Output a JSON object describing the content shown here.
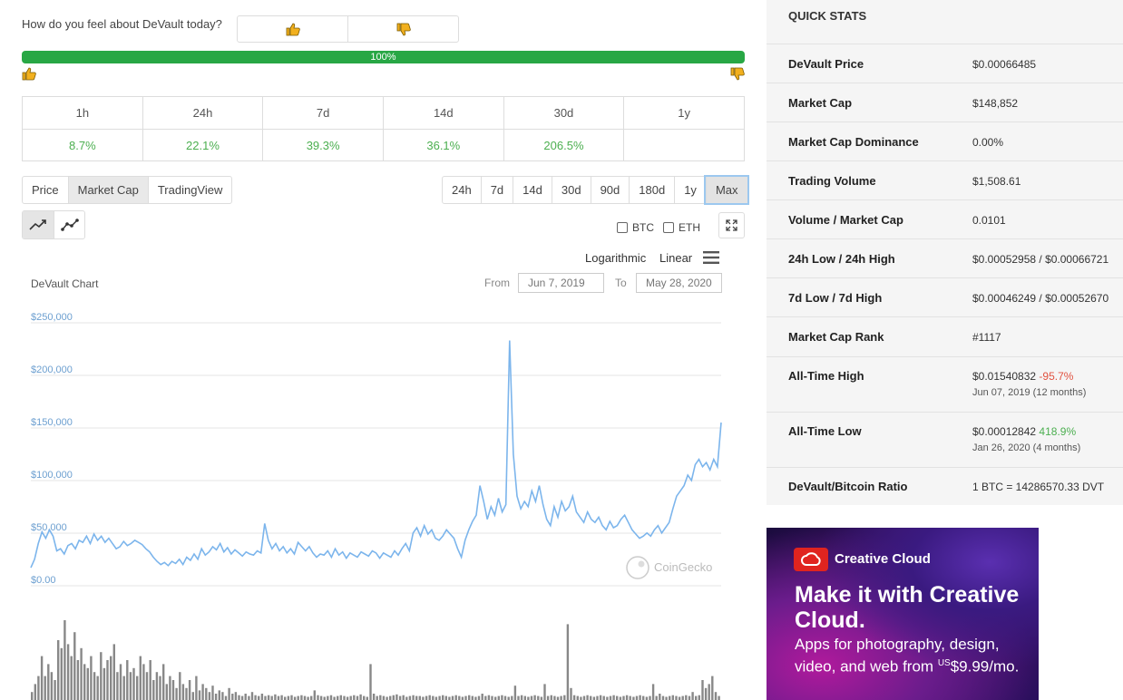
{
  "sentiment": {
    "question": "How do you feel about DeVault today?",
    "up_pct_label": "100%",
    "up_fraction": 1.0
  },
  "periods": {
    "headers": [
      "1h",
      "24h",
      "7d",
      "14d",
      "30d",
      "1y"
    ],
    "values": [
      "8.7%",
      "22.1%",
      "39.3%",
      "36.1%",
      "206.5%",
      ""
    ]
  },
  "chart_tabs": [
    "Price",
    "Market Cap",
    "TradingView"
  ],
  "active_chart_tab": "Market Cap",
  "range_tabs": [
    "24h",
    "7d",
    "14d",
    "30d",
    "90d",
    "180d",
    "1y",
    "Max"
  ],
  "active_range": "Max",
  "compare": {
    "btc": "BTC",
    "eth": "ETH"
  },
  "scale": {
    "log": "Logarithmic",
    "linear": "Linear"
  },
  "chart_title": "DeVault Chart",
  "date_range": {
    "from_label": "From",
    "from": "Jun 7, 2019",
    "to_label": "To",
    "to": "May 28, 2020"
  },
  "watermark": "CoinGecko",
  "chart_data": {
    "type": "area",
    "title": "DeVault Chart",
    "xlabel": "",
    "ylabel": "",
    "ylim": [
      0,
      250000
    ],
    "yticks": [
      "$0.00",
      "$50,000",
      "$100,000",
      "$150,000",
      "$200,000",
      "$250,000"
    ],
    "x_range": [
      "2019-06-07",
      "2020-05-28"
    ],
    "series": [
      {
        "values": [
          12000,
          20000,
          35000,
          46000,
          40000,
          48000,
          42000,
          28000,
          30000,
          25000,
          33000,
          35000,
          30000,
          38000,
          36000,
          42000,
          35000,
          44000,
          38000,
          42000,
          36000,
          40000,
          35000,
          30000,
          32000,
          37000,
          33000,
          35000,
          38000,
          36000,
          34000,
          30000,
          27000,
          22000,
          18000,
          15000,
          17000,
          14000,
          18000,
          16000,
          20000,
          15000,
          22000,
          19000,
          25000,
          20000,
          30000,
          24000,
          27000,
          32000,
          29000,
          35000,
          27000,
          31000,
          25000,
          29000,
          26000,
          23000,
          27000,
          25000,
          24000,
          28000,
          26000,
          54000,
          38000,
          30000,
          35000,
          28000,
          32000,
          26000,
          30000,
          25000,
          36000,
          32000,
          28000,
          32000,
          26000,
          22000,
          25000,
          24000,
          28000,
          22000,
          30000,
          24000,
          27000,
          21000,
          26000,
          24000,
          22000,
          27000,
          25000,
          23000,
          28000,
          26000,
          21000,
          26000,
          24000,
          22000,
          28000,
          24000,
          30000,
          35000,
          28000,
          45000,
          50000,
          42000,
          52000,
          44000,
          48000,
          40000,
          38000,
          42000,
          48000,
          44000,
          40000,
          30000,
          22000,
          38000,
          48000,
          56000,
          62000,
          90000,
          75000,
          58000,
          70000,
          62000,
          78000,
          65000,
          72000,
          228000,
          120000,
          80000,
          68000,
          75000,
          70000,
          85000,
          75000,
          90000,
          72000,
          58000,
          52000,
          70000,
          60000,
          75000,
          66000,
          70000,
          80000,
          65000,
          60000,
          55000,
          65000,
          58000,
          55000,
          60000,
          52000,
          48000,
          56000,
          50000,
          52000,
          58000,
          62000,
          55000,
          48000,
          44000,
          40000,
          42000,
          45000,
          42000,
          48000,
          52000,
          45000,
          50000,
          55000,
          68000,
          80000,
          85000,
          90000,
          100000,
          95000,
          110000,
          115000,
          108000,
          112000,
          105000,
          115000,
          108000,
          150000
        ]
      }
    ],
    "volume_relative": [
      0.1,
      0.2,
      0.3,
      0.55,
      0.3,
      0.45,
      0.35,
      0.25,
      0.75,
      0.65,
      1.0,
      0.7,
      0.55,
      0.85,
      0.5,
      0.65,
      0.45,
      0.4,
      0.55,
      0.35,
      0.3,
      0.6,
      0.4,
      0.5,
      0.55,
      0.7,
      0.35,
      0.45,
      0.3,
      0.5,
      0.35,
      0.4,
      0.3,
      0.55,
      0.45,
      0.35,
      0.5,
      0.25,
      0.35,
      0.3,
      0.45,
      0.2,
      0.3,
      0.25,
      0.15,
      0.35,
      0.2,
      0.15,
      0.25,
      0.1,
      0.3,
      0.12,
      0.2,
      0.15,
      0.1,
      0.18,
      0.08,
      0.12,
      0.1,
      0.05,
      0.15,
      0.08,
      0.1,
      0.06,
      0.05,
      0.08,
      0.05,
      0.1,
      0.06,
      0.05,
      0.08,
      0.05,
      0.06,
      0.05,
      0.07,
      0.05,
      0.06,
      0.04,
      0.05,
      0.06,
      0.04,
      0.05,
      0.06,
      0.05,
      0.04,
      0.05,
      0.12,
      0.06,
      0.05,
      0.04,
      0.05,
      0.06,
      0.04,
      0.05,
      0.06,
      0.05,
      0.04,
      0.05,
      0.06,
      0.05,
      0.07,
      0.05,
      0.04,
      0.45,
      0.08,
      0.05,
      0.06,
      0.05,
      0.04,
      0.05,
      0.06,
      0.07,
      0.05,
      0.06,
      0.04,
      0.05,
      0.06,
      0.05,
      0.05,
      0.04,
      0.05,
      0.06,
      0.05,
      0.04,
      0.05,
      0.06,
      0.05,
      0.04,
      0.05,
      0.06,
      0.05,
      0.04,
      0.05,
      0.06,
      0.05,
      0.04,
      0.05,
      0.08,
      0.05,
      0.06,
      0.05,
      0.04,
      0.05,
      0.06,
      0.05,
      0.04,
      0.05,
      0.18,
      0.05,
      0.06,
      0.05,
      0.04,
      0.05,
      0.06,
      0.05,
      0.04,
      0.2,
      0.05,
      0.06,
      0.05,
      0.04,
      0.05,
      0.06,
      0.95,
      0.15,
      0.06,
      0.05,
      0.04,
      0.05,
      0.06,
      0.05,
      0.04,
      0.05,
      0.06,
      0.05,
      0.04,
      0.05,
      0.06,
      0.05,
      0.04,
      0.05,
      0.06,
      0.05,
      0.04,
      0.05,
      0.06,
      0.05,
      0.04,
      0.05,
      0.2,
      0.05,
      0.08,
      0.05,
      0.04,
      0.05,
      0.06,
      0.05,
      0.04,
      0.05,
      0.06,
      0.05,
      0.1,
      0.05,
      0.06,
      0.25,
      0.15,
      0.2,
      0.3,
      0.1,
      0.05
    ]
  },
  "quick_stats": {
    "title": "QUICK STATS",
    "rows": [
      {
        "label": "DeVault Price",
        "value": "$0.00066485"
      },
      {
        "label": "Market Cap",
        "value": "$148,852"
      },
      {
        "label": "Market Cap Dominance",
        "value": "0.00%"
      },
      {
        "label": "Trading Volume",
        "value": "$1,508.61"
      },
      {
        "label": "Volume / Market Cap",
        "value": "0.0101"
      },
      {
        "label": "24h Low / 24h High",
        "value": "$0.00052958 / $0.00066721"
      },
      {
        "label": "7d Low / 7d High",
        "value": "$0.00046249 / $0.00052670"
      },
      {
        "label": "Market Cap Rank",
        "value": "#1117"
      }
    ],
    "ath": {
      "label": "All-Time High",
      "value": "$0.01540832",
      "change": "-95.7%",
      "date": "Jun 07, 2019 (12 months)"
    },
    "atl": {
      "label": "All-Time Low",
      "value": "$0.00012842",
      "change": "418.9%",
      "date": "Jan 26, 2020 (4 months)"
    },
    "ratio": {
      "label": "DeVault/Bitcoin Ratio",
      "value": "1 BTC = 14286570.33 DVT"
    }
  },
  "ad": {
    "brand": "Creative Cloud",
    "headline": "Make it with Creative Cloud.",
    "body_pre": "Apps for photography, design, video, and web from ",
    "currency_prefix": "US",
    "price": "$9.99/mo."
  },
  "colors": {
    "green": "#28a745",
    "positive": "#4caf50",
    "negative": "#e15241",
    "chart_line": "#7cb5ec",
    "volume_bar": "#888888"
  }
}
